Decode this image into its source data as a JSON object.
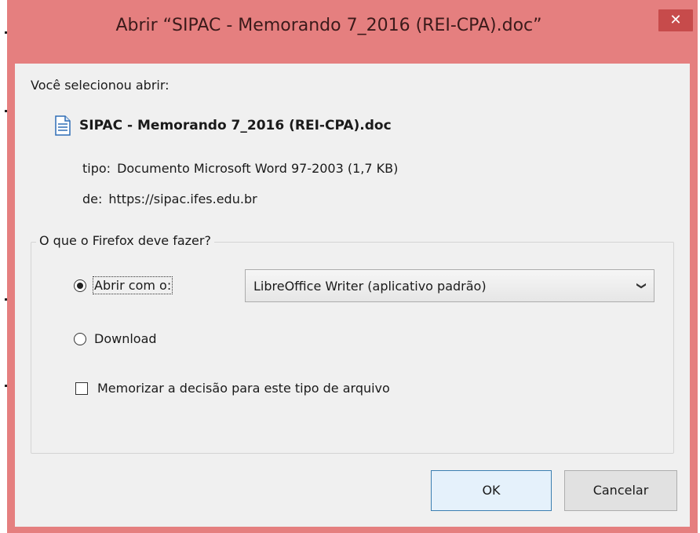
{
  "window": {
    "title": "Abrir “SIPAC - Memorando 7_2016 (REI-CPA).doc”",
    "close_symbol": "✕",
    "accent_color": "#e57f7f"
  },
  "intro_text": "Você selecionou abrir:",
  "file": {
    "icon": "document-icon",
    "name": "SIPAC - Memorando 7_2016 (REI-CPA).doc",
    "type_label": "tipo:",
    "type_value": "Documento Microsoft Word 97-2003 (1,7 KB)",
    "from_label": "de:",
    "from_value": "https://sipac.ifes.edu.br"
  },
  "action_group": {
    "legend": "O que o Firefox deve fazer?",
    "open_with": {
      "label": "Abrir com o:",
      "checked": true,
      "app_selected": "LibreOffice Writer (aplicativo padrão)"
    },
    "download": {
      "label": "Download",
      "checked": false
    },
    "remember": {
      "label": "Memorizar a decisão para este tipo de arquivo",
      "checked": false
    }
  },
  "buttons": {
    "ok": "OK",
    "cancel": "Cancelar"
  }
}
